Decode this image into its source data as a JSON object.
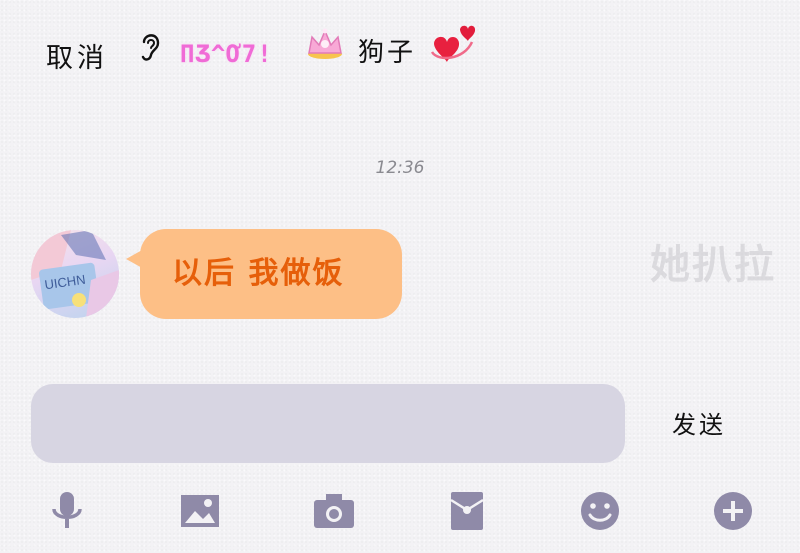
{
  "header": {
    "cancel_label": "取消",
    "nickname_deco": "ΠƷ^Ơ7!",
    "nickname": "狗子"
  },
  "chat": {
    "timestamp": "12:36",
    "messages": [
      {
        "sender": "other",
        "text": "以后 我做饭"
      }
    ],
    "ghost_text": "她扒拉"
  },
  "composer": {
    "input_value": "",
    "send_label": "发送"
  },
  "toolbar": {
    "icons": [
      "microphone-icon",
      "image-icon",
      "camera-icon",
      "red-packet-icon",
      "emoji-icon",
      "plus-icon"
    ]
  },
  "colors": {
    "background": "#f3f2f5",
    "bubble": "#fdbf86",
    "bubble_text": "#e65f0a",
    "input": "#d7d5e2",
    "toolbar_icon": "#8f8aa8",
    "nickname_deco": "#f06bd6"
  }
}
